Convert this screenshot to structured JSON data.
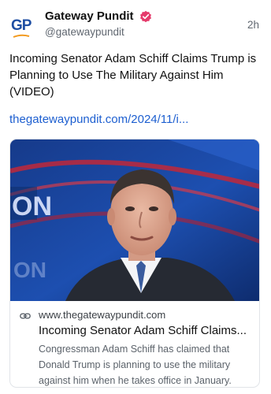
{
  "post": {
    "author_name": "Gateway Pundit",
    "handle": "@gatewaypundit",
    "time": "2h",
    "avatar_text": "GP",
    "text": "Incoming Senator Adam Schiff Claims Trump is Planning to Use The Military Against Him (VIDEO)",
    "link": "thegatewaypundit.com/2024/11/i..."
  },
  "card": {
    "image_overlay_text": "ON",
    "domain": "www.thegatewaypundit.com",
    "title": "Incoming Senator Adam Schiff Claims...",
    "description": "Congressman Adam Schiff has claimed that Donald Trump is planning to use the military against him when he takes office in January."
  },
  "icons": {
    "verified": "verified-badge-icon",
    "link": "link-icon"
  },
  "colors": {
    "verified_badge": "#e53a6b",
    "link": "#1d5fd0",
    "avatar_blue": "#1f4fa3",
    "avatar_orange": "#f29a1f"
  }
}
